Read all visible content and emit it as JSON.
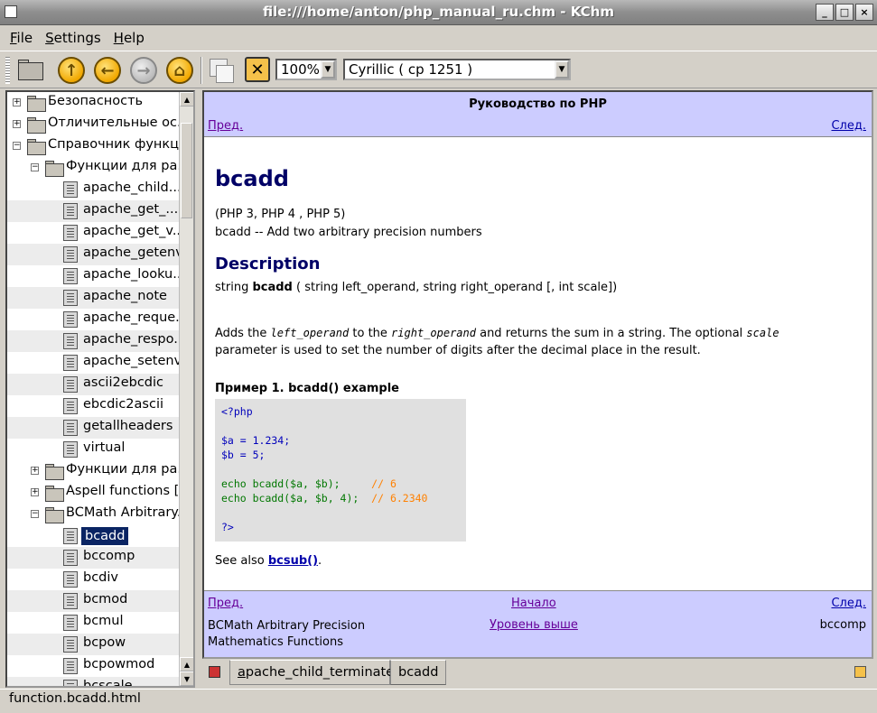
{
  "window": {
    "title": "file:///home/anton/php_manual_ru.chm - KChm",
    "buttons": [
      "_",
      "□",
      "×"
    ]
  },
  "menu": [
    {
      "label": "File",
      "mnemonic": "F",
      "rest": "ile"
    },
    {
      "label": "Settings",
      "mnemonic": "S",
      "rest": "ettings"
    },
    {
      "label": "Help",
      "mnemonic": "H",
      "rest": "elp"
    }
  ],
  "toolbar": {
    "icons": [
      "open-folder-icon",
      "up-arrow-icon",
      "back-arrow-icon",
      "forward-arrow-icon",
      "home-icon",
      "copy-icon",
      "close-tab-icon"
    ],
    "up_glyph": "↑",
    "back_glyph": "←",
    "forward_glyph": "→",
    "home_glyph": "⌂",
    "close_glyph": "✕",
    "zoom": "100%",
    "encoding": "Cyrillic ( cp 1251 )",
    "combo_arrow": "▼"
  },
  "tree": {
    "items": [
      {
        "label": "Безопасность",
        "level": 0,
        "type": "folder",
        "expander": "+"
      },
      {
        "label": "Отличительные ос...",
        "level": 0,
        "type": "folder",
        "expander": "+"
      },
      {
        "label": "Справочник функций",
        "level": 0,
        "type": "folder",
        "expander": "−"
      },
      {
        "label": "Функции для ра...",
        "level": 1,
        "type": "folder",
        "expander": "−"
      },
      {
        "label": "apache_child...",
        "level": 2,
        "type": "page"
      },
      {
        "label": "apache_get_...",
        "level": 2,
        "type": "page"
      },
      {
        "label": "apache_get_v...",
        "level": 2,
        "type": "page"
      },
      {
        "label": "apache_getenv",
        "level": 2,
        "type": "page"
      },
      {
        "label": "apache_looku...",
        "level": 2,
        "type": "page"
      },
      {
        "label": "apache_note",
        "level": 2,
        "type": "page"
      },
      {
        "label": "apache_reque...",
        "level": 2,
        "type": "page"
      },
      {
        "label": "apache_respo...",
        "level": 2,
        "type": "page"
      },
      {
        "label": "apache_setenv",
        "level": 2,
        "type": "page"
      },
      {
        "label": "ascii2ebcdic",
        "level": 2,
        "type": "page"
      },
      {
        "label": "ebcdic2ascii",
        "level": 2,
        "type": "page"
      },
      {
        "label": "getallheaders",
        "level": 2,
        "type": "page"
      },
      {
        "label": "virtual",
        "level": 2,
        "type": "page"
      },
      {
        "label": "Функции для ра...",
        "level": 1,
        "type": "folder",
        "expander": "+"
      },
      {
        "label": "Aspell functions [...",
        "level": 1,
        "type": "folder",
        "expander": "+"
      },
      {
        "label": "BCMath Arbitrary...",
        "level": 1,
        "type": "folder",
        "expander": "−"
      },
      {
        "label": "bcadd",
        "level": 2,
        "type": "page",
        "selected": true
      },
      {
        "label": "bccomp",
        "level": 2,
        "type": "page"
      },
      {
        "label": "bcdiv",
        "level": 2,
        "type": "page"
      },
      {
        "label": "bcmod",
        "level": 2,
        "type": "page"
      },
      {
        "label": "bcmul",
        "level": 2,
        "type": "page"
      },
      {
        "label": "bcpow",
        "level": 2,
        "type": "page"
      },
      {
        "label": "bcpowmod",
        "level": 2,
        "type": "page"
      },
      {
        "label": "bcscale",
        "level": 2,
        "type": "page"
      }
    ],
    "scroll_up": "▲",
    "scroll_down": "▼"
  },
  "page": {
    "header_title": "Руководство по PHP",
    "prev": "Пред.",
    "next": "След.",
    "heading": "bcadd",
    "versions": "(PHP 3, PHP 4 , PHP 5)",
    "refpurpose": "bcadd -- Add two arbitrary precision numbers",
    "description_heading": "Description",
    "synopsis_type": "string ",
    "synopsis_func": "bcadd",
    "synopsis_args": " ( string left_operand, string right_operand [, int scale])",
    "para_1": "Adds the ",
    "param_left": "left_operand",
    "para_2": " to the ",
    "param_right": "right_operand",
    "para_3": " and returns the sum in a string. The optional ",
    "param_scale": "scale",
    "para_4": "parameter is used to set the number of digits after the decimal place in the result.",
    "example_title": "Пример 1. bcadd() example",
    "code": {
      "open": "<?php",
      "line_a": "$a = 1.234;",
      "line_b": "$b = 5;",
      "echo1": "echo bcadd($a, $b);     ",
      "echo1_comment": "// 6",
      "echo2": "echo bcadd($a, $b, 4);  ",
      "echo2_comment": "// 6.2340",
      "close": "?>"
    },
    "see_also": "See also ",
    "see_also_link": "bcsub()",
    "see_also_end": ".",
    "footer": {
      "prev": "Пред.",
      "home": "Начало",
      "next": "След.",
      "prev_title_1": "BCMath Arbitrary Precision",
      "prev_title_2": "Mathematics Functions",
      "up": "Уровень выше",
      "next_title": "bccomp"
    }
  },
  "tabs": [
    {
      "label_mn": "a",
      "label_rest": "pache_child_terminate",
      "active": false
    },
    {
      "label_mn": "",
      "label_rest": "bcadd",
      "active": true
    }
  ],
  "status": "function.bcadd.html",
  "colors": {
    "nav_bg": "#ccccff",
    "selection": "#0a2463",
    "heading": "#000066"
  }
}
